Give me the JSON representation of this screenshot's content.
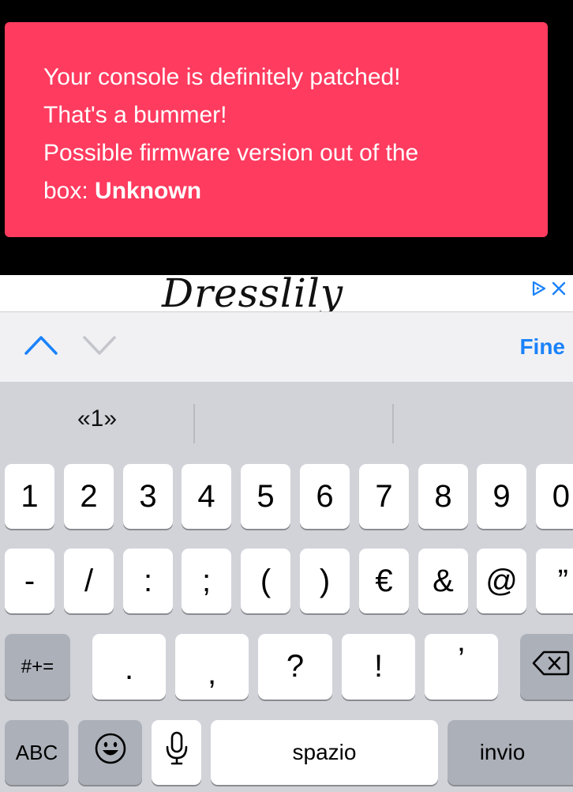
{
  "alert": {
    "line1": "Your console is definitely patched!",
    "line2": "That's a bummer!",
    "line3": "Possible firmware version out of the",
    "line4_prefix": "box: ",
    "line4_value": "Unknown"
  },
  "ad": {
    "logo_text": "Dresslily",
    "icons": [
      "adchoices-icon",
      "close-icon"
    ],
    "accent": "#1a82fb"
  },
  "accessory": {
    "done_label": "Fine"
  },
  "keyboard": {
    "suggestions": [
      "«1»",
      "",
      ""
    ],
    "row1": [
      "1",
      "2",
      "3",
      "4",
      "5",
      "6",
      "7",
      "8",
      "9",
      "0"
    ],
    "row2": [
      "-",
      "/",
      ":",
      ";",
      "(",
      ")",
      "€",
      "&",
      "@",
      "”"
    ],
    "row3": {
      "mode": "#+=",
      "keys": [
        ".",
        ",",
        "?",
        "!",
        "’"
      ]
    },
    "row4": {
      "abc": "ABC",
      "emoji": "emoji-icon",
      "mic": "microphone-icon",
      "space": "spazio",
      "return": "invio"
    }
  },
  "colors": {
    "alert_bg": "#ff3b5f",
    "keyboard_bg": "#d1d3d9",
    "key_bg": "#ffffff",
    "dark_key_bg": "#acb0b9"
  }
}
